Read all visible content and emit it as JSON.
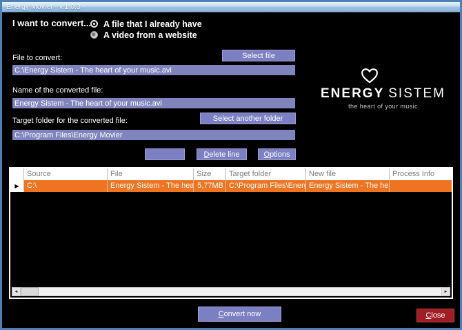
{
  "window": {
    "title": "Energy Movier - v.1.0.3 -"
  },
  "colors": {
    "accent_purple": "#7c80c3",
    "input_purple": "#8084bc",
    "row_orange": "#ee7421",
    "close_red": "#9f1d24",
    "titlebar_blue": "#9dc0e0"
  },
  "convert_prompt": {
    "label": "I want to convert...",
    "options": [
      {
        "label": "A file that I already have",
        "selected": true
      },
      {
        "label": "A video from a website",
        "selected": false
      }
    ]
  },
  "file_section": {
    "label": "File to convert:",
    "button": "Select file",
    "value": "C:\\Energy Sistem - The heart of your music.avi"
  },
  "name_section": {
    "label": "Name of the converted file:",
    "value": "Energy Sistem - The heart of your music.avi"
  },
  "target_section": {
    "label": "Target folder for the converted file:",
    "button": "Select another folder",
    "value": "C:\\Program Files\\Energy Movier"
  },
  "actions": {
    "delete_line": {
      "mnemonic": "D",
      "rest": "elete line"
    },
    "options": {
      "mnemonic": "O",
      "rest": "ptions"
    }
  },
  "logo": {
    "brand_bold": "ENERGY",
    "brand_light": "SISTEM",
    "tagline": "the heart of your music"
  },
  "table": {
    "columns": [
      "",
      "Source",
      "File",
      "Size",
      "Target folder",
      "New file",
      "Process Info"
    ],
    "rows": [
      {
        "source": "C:\\",
        "file": "Energy Sistem - The heart of your music.avi",
        "size": "5,77MB",
        "target_folder": "C:\\Program Files\\Energy Movier",
        "new_file": "Energy Sistem - The heart of your music.avi",
        "process_info": ""
      }
    ]
  },
  "icons": {
    "row_selector": "▶",
    "scroll_left": "◄",
    "scroll_right": "►"
  },
  "footer": {
    "convert": {
      "mnemonic": "C",
      "rest": "onvert now"
    },
    "close": {
      "mnemonic": "C",
      "rest": "lose"
    }
  }
}
